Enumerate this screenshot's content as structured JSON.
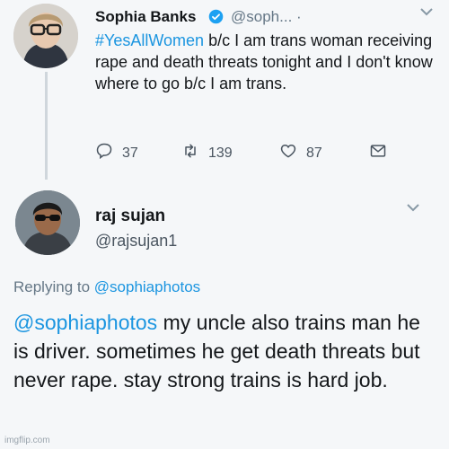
{
  "tweet1": {
    "name": "Sophia Banks",
    "handle": "@soph... ·",
    "hashtag": "#YesAllWomen",
    "text": " b/c I am trans woman receiving rape and death threats tonight and I don't know where to go b/c I am trans.",
    "reply_count": "37",
    "retweet_count": "139",
    "like_count": "87"
  },
  "tweet2": {
    "name": "raj sujan",
    "handle": "@rajsujan1",
    "replying_prefix": "Replying to ",
    "replying_to": "@sophiaphotos",
    "mention": "@sophiaphotos",
    "text": " my uncle also trains man he is driver. sometimes he get death threats but never rape. stay strong trains is hard job."
  },
  "watermark": "imgflip.com",
  "colors": {
    "link": "#1b95e0",
    "secondary": "#657786",
    "verified": "#1da1f2"
  },
  "icons": [
    "chevron-down-icon",
    "verified-badge-icon",
    "reply-icon",
    "retweet-icon",
    "like-icon",
    "message-icon"
  ]
}
